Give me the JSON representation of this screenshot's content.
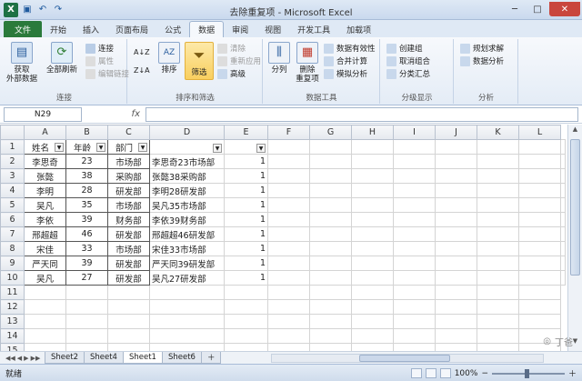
{
  "window": {
    "title": "去除重复项 - Microsoft Excel",
    "controls": {
      "minimize": "─",
      "maximize": "□",
      "close": "✕"
    }
  },
  "qat": {
    "app_icon": "X",
    "undo": "↶",
    "redo": "↷",
    "save": "▣"
  },
  "tabs": [
    {
      "label": "文件"
    },
    {
      "label": "开始"
    },
    {
      "label": "插入"
    },
    {
      "label": "页面布局"
    },
    {
      "label": "公式"
    },
    {
      "label": "数据"
    },
    {
      "label": "审阅"
    },
    {
      "label": "视图"
    },
    {
      "label": "开发工具"
    },
    {
      "label": "加载项"
    }
  ],
  "ribbon": {
    "get_external": "获取\n外部数据",
    "refresh_all": "全部刷新",
    "connections": "连接",
    "properties": "属性",
    "edit_links": "编辑链接",
    "group_connections": "连接",
    "sort_asc": "A↓Z",
    "sort_desc": "Z↓A",
    "sort": "排序",
    "filter": "筛选",
    "clear": "清除",
    "reapply": "重新应用",
    "advanced": "高级",
    "group_sort": "排序和筛选",
    "text_to_cols": "分列",
    "remove_dup": "删除\n重复项",
    "data_validation": "数据有效性",
    "consolidate": "合并计算",
    "what_if": "模拟分析",
    "group_datatools": "数据工具",
    "group": "创建组",
    "ungroup": "取消组合",
    "subtotal": "分类汇总",
    "group_outline": "分级显示",
    "solver": "规划求解",
    "data_analysis": "数据分析",
    "group_analysis": "分析"
  },
  "formula_bar": {
    "name_box": "N29",
    "fx": "fx",
    "value": ""
  },
  "sheet": {
    "columns": [
      "A",
      "B",
      "C",
      "D",
      "E",
      "F",
      "G",
      "H",
      "I",
      "J",
      "K",
      "L"
    ],
    "row_numbers": [
      "1",
      "2",
      "3",
      "4",
      "5",
      "6",
      "7",
      "8",
      "9",
      "10",
      "11",
      "12",
      "13",
      "14",
      "15"
    ],
    "headers": {
      "name": "姓名",
      "age": "年龄",
      "dept": "部门"
    },
    "rows": [
      {
        "name": "李思奇",
        "age": "23",
        "dept": "市场部",
        "combo": "李思奇23市场部",
        "e": "1"
      },
      {
        "name": "张懿",
        "age": "38",
        "dept": "采购部",
        "combo": "张懿38采购部",
        "e": "1"
      },
      {
        "name": "李明",
        "age": "28",
        "dept": "研发部",
        "combo": "李明28研发部",
        "e": "1"
      },
      {
        "name": "吴凡",
        "age": "35",
        "dept": "市场部",
        "combo": "吴凡35市场部",
        "e": "1"
      },
      {
        "name": "李依",
        "age": "39",
        "dept": "财务部",
        "combo": "李依39财务部",
        "e": "1"
      },
      {
        "name": "邢超超",
        "age": "46",
        "dept": "研发部",
        "combo": "邢超超46研发部",
        "e": "1"
      },
      {
        "name": "宋佳",
        "age": "33",
        "dept": "市场部",
        "combo": "宋佳33市场部",
        "e": "1"
      },
      {
        "name": "严天同",
        "age": "39",
        "dept": "研发部",
        "combo": "严天同39研发部",
        "e": "1"
      },
      {
        "name": "吴凡",
        "age": "27",
        "dept": "研发部",
        "combo": "吴凡27研发部",
        "e": "1"
      }
    ]
  },
  "sheet_tabs": [
    {
      "label": "Sheet2"
    },
    {
      "label": "Sheet4"
    },
    {
      "label": "Sheet1"
    },
    {
      "label": "Sheet6"
    }
  ],
  "status": {
    "ready": "就绪",
    "zoom": "100%"
  },
  "watermark": "丁爸"
}
